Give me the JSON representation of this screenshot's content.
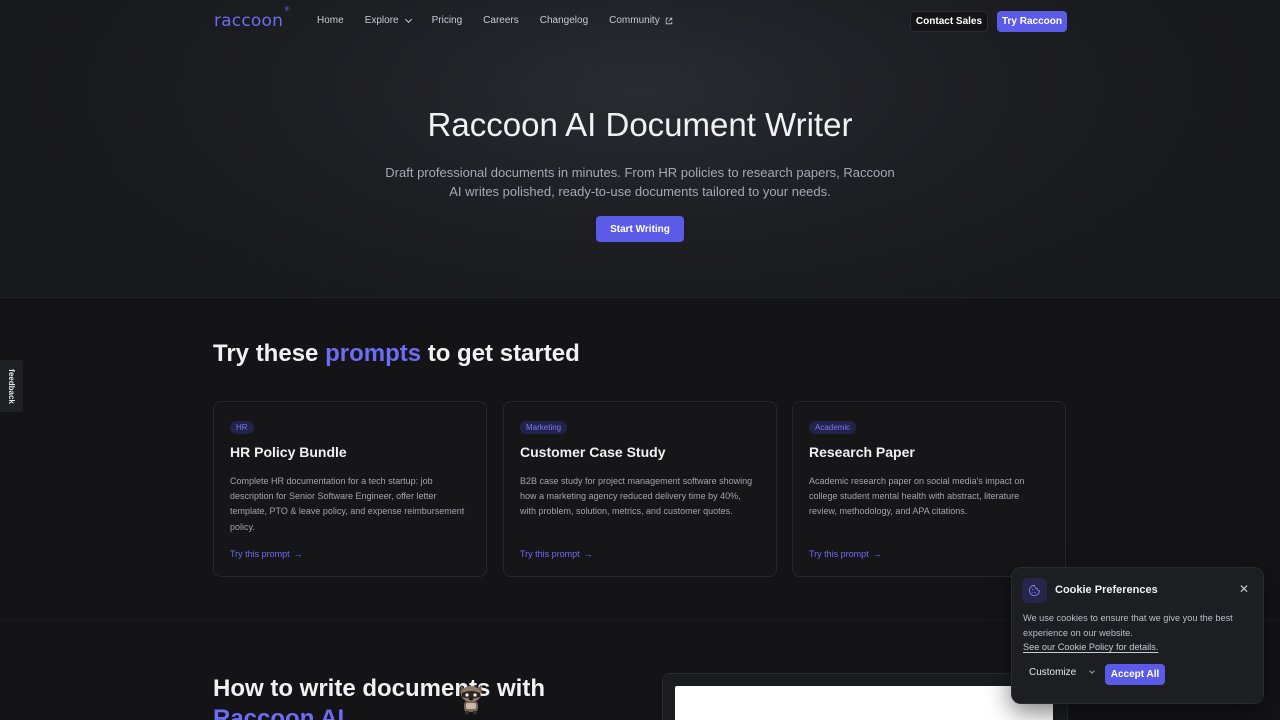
{
  "nav": {
    "logo": "raccoon",
    "logo_mark": "®",
    "links": [
      {
        "label": "Home"
      },
      {
        "label": "Explore"
      },
      {
        "label": "Pricing"
      },
      {
        "label": "Careers"
      },
      {
        "label": "Changelog"
      },
      {
        "label": "Community"
      }
    ],
    "contact_label": "Contact Sales",
    "try_label": "Try Raccoon"
  },
  "hero": {
    "title": "Raccoon AI Document Writer",
    "subtitle": "Draft professional documents in minutes. From HR policies to research papers, Raccoon AI writes polished, ready-to-use documents tailored to your needs.",
    "cta_label": "Start Writing"
  },
  "feedback_label": "feedback",
  "prompts": {
    "title_before": "Try these ",
    "title_accent": "prompts",
    "title_after": " to get started",
    "cards": [
      {
        "badge": "HR",
        "title": "HR Policy Bundle",
        "description": "Complete HR documentation for a tech startup: job description for Senior Software Engineer, offer letter template, PTO & leave policy, and expense reimbursement policy.",
        "cta": "Try this prompt"
      },
      {
        "badge": "Marketing",
        "title": "Customer Case Study",
        "description": "B2B case study for project management software showing how a marketing agency reduced delivery time by 40%, with problem, solution, metrics, and customer quotes.",
        "cta": "Try this prompt"
      },
      {
        "badge": "Academic",
        "title": "Research Paper",
        "description": "Academic research paper on social media's impact on college student mental health with abstract, literature review, methodology, and APA citations.",
        "cta": "Try this prompt"
      }
    ]
  },
  "how_to": {
    "title_before": "How to write documents with ",
    "title_accent": "Raccoon AI"
  },
  "cookie": {
    "title": "Cookie Preferences",
    "text": "We use cookies to ensure that we give you the best experience on our website.",
    "link": "See our Cookie Policy for details.",
    "customize_label": "Customize",
    "accept_label": "Accept All"
  },
  "colors": {
    "accent": "#5B5BE8",
    "accent_text": "#6C6CF5",
    "background": "#141416"
  }
}
